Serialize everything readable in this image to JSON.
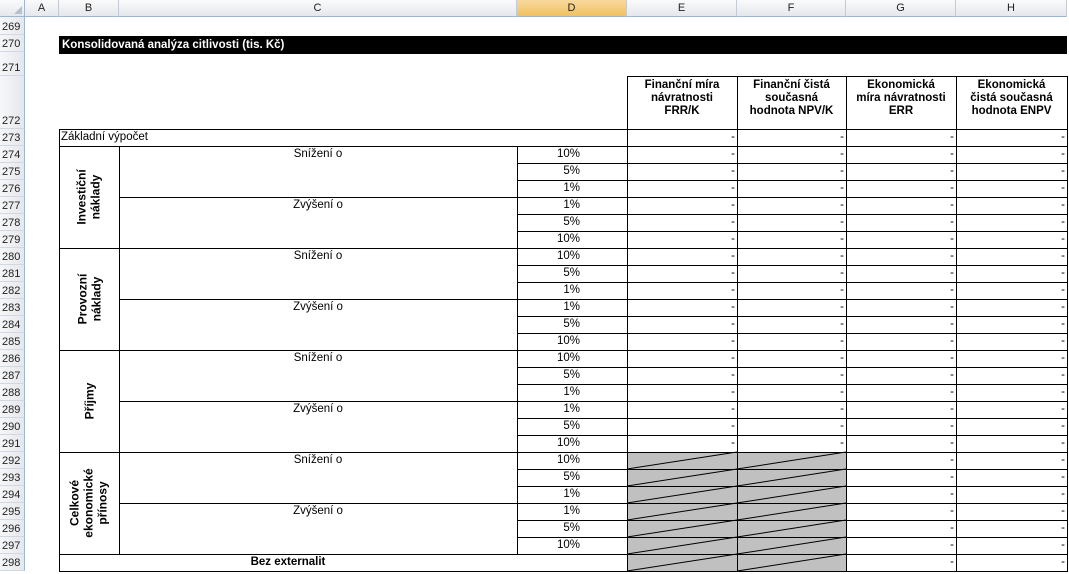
{
  "columns": [
    "A",
    "B",
    "C",
    "D",
    "E",
    "F",
    "G",
    "H"
  ],
  "selected_column": "D",
  "row_numbers": [
    "269",
    "270",
    "271",
    "272",
    "273",
    "274",
    "275",
    "276",
    "277",
    "278",
    "279",
    "280",
    "281",
    "282",
    "283",
    "284",
    "285",
    "286",
    "287",
    "288",
    "289",
    "290",
    "291",
    "292",
    "293",
    "294",
    "295",
    "296",
    "297",
    "298"
  ],
  "title": "Konsolidovaná analýza citlivosti (tis. Kč)",
  "headers": {
    "e": [
      "Finanční míra",
      "návratnosti",
      "FRR/K"
    ],
    "f": [
      "Finanční čistá",
      "současná",
      "hodnota NPV/K"
    ],
    "g": [
      "Ekonomická",
      "míra návratnosti",
      "ERR"
    ],
    "h": [
      "Ekonomická",
      "čistá současná",
      "hodnota ENPV"
    ]
  },
  "base_label": "Základní výpočet",
  "groups": [
    {
      "label_lines": [
        "Investiční",
        "náklady"
      ]
    },
    {
      "label_lines": [
        "Provozní",
        "náklady"
      ]
    },
    {
      "label_lines": [
        "Příjmy"
      ]
    },
    {
      "label_lines": [
        "Celkové",
        "ekonomické",
        "přínosy"
      ]
    }
  ],
  "decrease_label": "Snížení o",
  "increase_label": "Zvýšení o",
  "pct_sequence": [
    "10%",
    "5%",
    "1%",
    "1%",
    "5%",
    "10%"
  ],
  "dash": "-",
  "no_externalities_label": "Bez externalit",
  "colors": {
    "title_bg": "#000000",
    "shaded_cells": "#c0c0c0",
    "header_bg": "#e4e7ec",
    "selected_header_bg": "#f1c15f"
  }
}
